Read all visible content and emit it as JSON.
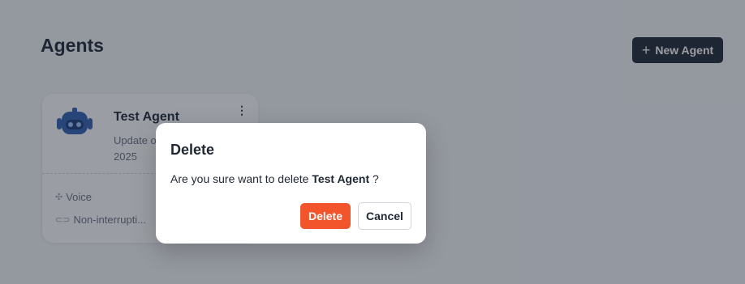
{
  "page": {
    "title": "Agents"
  },
  "toolbar": {
    "new_agent_label": "New Agent",
    "new_agent_icon": "plus-icon"
  },
  "agent_card": {
    "name": "Test Agent",
    "updated": "Update on ... 2025",
    "updated_line1": "Update o",
    "updated_line2": "2025",
    "tags": [
      {
        "icon": "waveform-icon",
        "label": "Voice"
      },
      {
        "icon": "link-icon",
        "label": "Non-interrupti..."
      }
    ]
  },
  "dialog": {
    "title": "Delete",
    "message_prefix": "Are you sure want to delete ",
    "agent_name": "Test Agent",
    "message_suffix": " ?",
    "delete_label": "Delete",
    "cancel_label": "Cancel"
  },
  "colors": {
    "primary_dark": "#1f2733",
    "danger": "#f2552c",
    "overlay": "rgba(30,38,52,0.45)"
  }
}
